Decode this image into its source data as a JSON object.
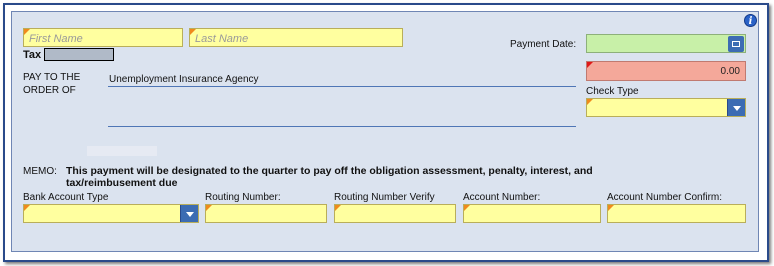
{
  "first_name": {
    "placeholder": "First Name",
    "value": ""
  },
  "last_name": {
    "placeholder": "Last Name",
    "value": ""
  },
  "tax_label": "Tax",
  "payment_date_label": "Payment Date:",
  "amount_value": "0.00",
  "pay_to_label_line1": "PAY TO THE",
  "pay_to_label_line2": "ORDER OF",
  "payee_name": "Unemployment Insurance Agency",
  "check_type_label": "Check Type",
  "memo_label": "MEMO:",
  "memo_text_line1": "This payment will be designated to the quarter to pay off the obligation assessment, penalty, interest, and",
  "memo_text_line2": "tax/reimbusement due",
  "bank_account_type_label": "Bank Account Type",
  "routing_number_label": "Routing Number:",
  "routing_number_verify_label": "Routing Number Verify",
  "account_number_label": "Account Number:",
  "account_number_confirm_label": "Account Number Confirm:",
  "info_icon_glyph": "i",
  "colors": {
    "required_field": "#ffff9f",
    "date_field": "#c8f0a8",
    "amount_field": "#f4a89a",
    "panel": "#dbe3ef",
    "accent": "#3c6cb3"
  }
}
